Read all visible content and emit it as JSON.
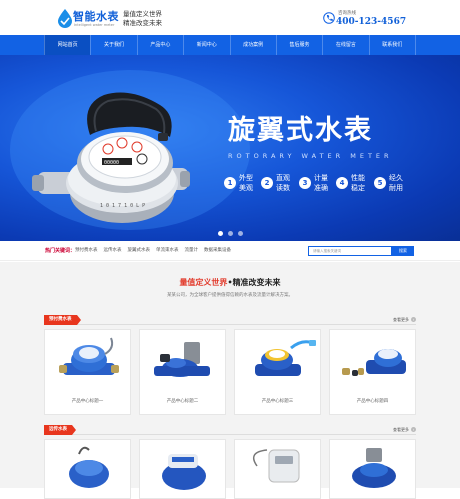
{
  "header": {
    "logo_name": "智能水表",
    "logo_sub": "Intelligent water meter",
    "slogan_line1": "量值定义世界",
    "slogan_line2": "精准改变未来",
    "phone_label": "咨询热线",
    "phone": "400-123-4567"
  },
  "nav": {
    "items": [
      "网站首页",
      "关于我们",
      "产品中心",
      "新闻中心",
      "成功案例",
      "售后服务",
      "在线留言",
      "联系我们"
    ]
  },
  "banner": {
    "title": "旋翼式水表",
    "subtitle": "ROTORARY WATER METER",
    "features": [
      {
        "num": "1",
        "text": "外型美观"
      },
      {
        "num": "2",
        "text": "直观读数"
      },
      {
        "num": "3",
        "text": "计量准确"
      },
      {
        "num": "4",
        "text": "性能稳定"
      },
      {
        "num": "5",
        "text": "经久耐用"
      }
    ],
    "meter_label": "1 0 1 7 1 0 L P"
  },
  "keywords": {
    "title": "热门关键词：",
    "items": [
      "预付费水表",
      "远传水表",
      "旋翼式水表",
      "单流束水表",
      "流量计",
      "数据采集设备"
    ],
    "search_placeholder": "请输入搜索关键词",
    "search_button": "搜索"
  },
  "main": {
    "headline_red": "量值定义世界",
    "headline_dot": "•",
    "headline_dark": "精准改变未来",
    "sub": "某某公司，为全球客户提供值得信赖的水表及流量计解决方案。",
    "sections": [
      {
        "tag": "预付费水表",
        "more": "查看更多",
        "products": [
          "产品中心标题一",
          "产品中心标题二",
          "产品中心标题三",
          "产品中心标题四"
        ]
      },
      {
        "tag": "远传水表",
        "more": "查看更多",
        "products": []
      }
    ]
  },
  "colors": {
    "brand_blue": "#1262e4",
    "accent_red": "#e8361e"
  }
}
